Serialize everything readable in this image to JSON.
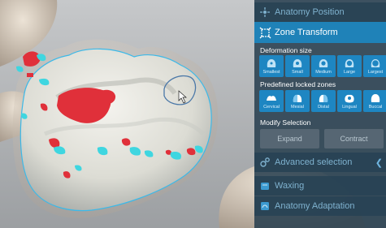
{
  "panel": {
    "anatomy_position": "Anatomy Position",
    "zone_transform": "Zone Transform",
    "deformation_size": {
      "label": "Deformation size",
      "buttons": [
        "Smallest",
        "Small",
        "Medium",
        "Large",
        "Largest"
      ]
    },
    "locked_zones": {
      "label": "Predefined locked zones",
      "buttons": [
        "Cervical",
        "Mesial",
        "Distal",
        "Lingual",
        "Buccal"
      ]
    },
    "modify_selection": {
      "label": "Modify Selection",
      "expand": "Expand",
      "contract": "Contract"
    },
    "advanced_selection": "Advanced selection",
    "waxing": "Waxing",
    "anatomy_adaptation": "Anatomy Adaptation"
  },
  "colors": {
    "accent": "#1f82b8",
    "panel_bg": "#263e4e",
    "selection_red": "#e0303a",
    "contact_cyan": "#3fd6e0"
  }
}
